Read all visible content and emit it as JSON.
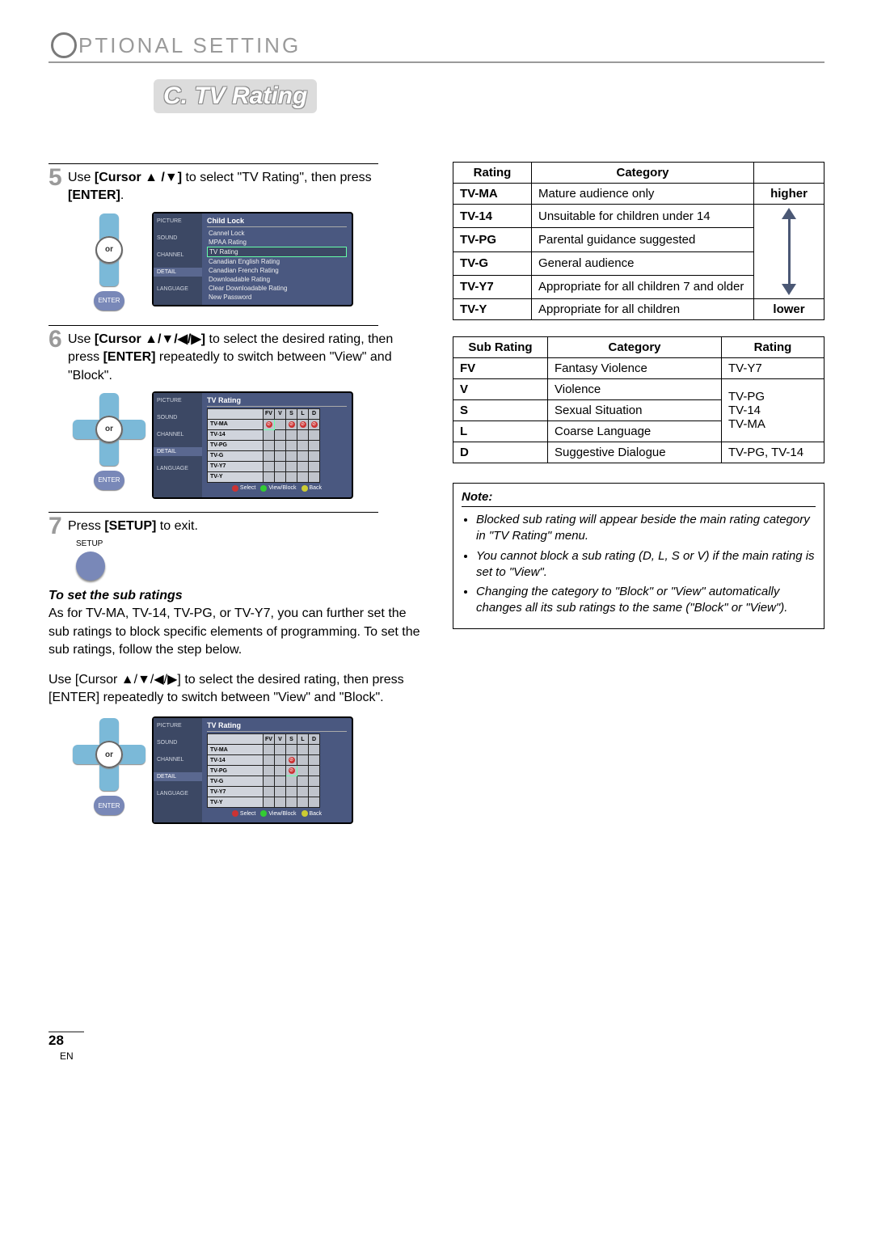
{
  "header": {
    "big_letter_rest": "PTIONAL  SETTING"
  },
  "section_title": "C. TV Rating",
  "steps": {
    "s5": {
      "num": "5",
      "pre": "Use ",
      "bold1": "[Cursor ▲ /▼]",
      "mid": " to select \"TV Rating\", then press ",
      "bold2": "[ENTER]",
      "post": "."
    },
    "s6": {
      "num": "6",
      "pre": "Use ",
      "bold1": "[Cursor ▲/▼/◀/▶]",
      "mid": " to select the desired rating, then press ",
      "bold2": "[ENTER]",
      "post": " repeatedly to switch between \"View\" and \"Block\"."
    },
    "s7": {
      "num": "7",
      "pre": "Press ",
      "bold1": "[SETUP]",
      "post": " to exit."
    }
  },
  "setup_label": "SETUP",
  "center_or": "or",
  "enter_label": "ENTER",
  "osd1": {
    "title": "Child Lock",
    "tabs": [
      "PICTURE",
      "SOUND",
      "CHANNEL",
      "DETAIL",
      "LANGUAGE"
    ],
    "items": [
      "Cannel Lock",
      "MPAA Rating",
      "TV Rating",
      "Canadian English Rating",
      "Canadian French Rating",
      "Downloadable Rating",
      "Clear Downloadable Rating",
      "New Password"
    ]
  },
  "osd2": {
    "title": "TV Rating",
    "tabs": [
      "PICTURE",
      "SOUND",
      "CHANNEL",
      "DETAIL",
      "LANGUAGE"
    ],
    "rows": [
      "TV-MA",
      "TV-14",
      "TV-PG",
      "TV-G",
      "TV-Y7",
      "TV-Y"
    ],
    "cols": [
      "FV",
      "V",
      "S",
      "L",
      "D"
    ],
    "foot": [
      "Select",
      "View/Block",
      "Back"
    ]
  },
  "sub": {
    "heading": "To set the sub ratings",
    "p1": "As for TV-MA, TV-14, TV-PG, or TV-Y7, you can further set the sub ratings to block specific elements of programming. To set the sub ratings, follow the step below.",
    "p2_pre": "Use ",
    "p2_b1": "[Cursor ▲/▼/◀/▶]",
    "p2_mid": " to select the desired rating, then press ",
    "p2_b2": "[ENTER]",
    "p2_post": " repeatedly to switch between \"View\" and \"Block\"."
  },
  "rt1": {
    "h1": "Rating",
    "h2": "Category",
    "rows": [
      {
        "r": "TV-MA",
        "c": "Mature audience only"
      },
      {
        "r": "TV-14",
        "c": "Unsuitable for children under 14"
      },
      {
        "r": "TV-PG",
        "c": "Parental guidance suggested"
      },
      {
        "r": "TV-G",
        "c": "General audience"
      },
      {
        "r": "TV-Y7",
        "c": "Appropriate for all children 7 and older"
      },
      {
        "r": "TV-Y",
        "c": "Appropriate for all children"
      }
    ],
    "top_label": "higher",
    "bottom_label": "lower"
  },
  "rt2": {
    "h1": "Sub Rating",
    "h2": "Category",
    "h3": "Rating",
    "rows": [
      {
        "s": "FV",
        "c": "Fantasy Violence",
        "r": "TV-Y7"
      },
      {
        "s": "V",
        "c": "Violence",
        "r": ""
      },
      {
        "s": "S",
        "c": "Sexual Situation",
        "r": ""
      },
      {
        "s": "L",
        "c": "Coarse Language",
        "r": ""
      },
      {
        "s": "D",
        "c": "Suggestive Dialogue",
        "r": "TV-PG, TV-14"
      }
    ],
    "merged_r": "TV-PG\nTV-14\nTV-MA"
  },
  "note": {
    "title": "Note:",
    "items": [
      "Blocked sub rating will appear beside the main rating category in \"TV Rating\" menu.",
      "You cannot block a sub rating (D, L, S or V) if the main rating is set to \"View\".",
      "Changing the category to \"Block\" or \"View\" automatically changes all its sub ratings to the same (\"Block\" or \"View\")."
    ]
  },
  "foot": {
    "page": "28",
    "lang": "EN"
  }
}
